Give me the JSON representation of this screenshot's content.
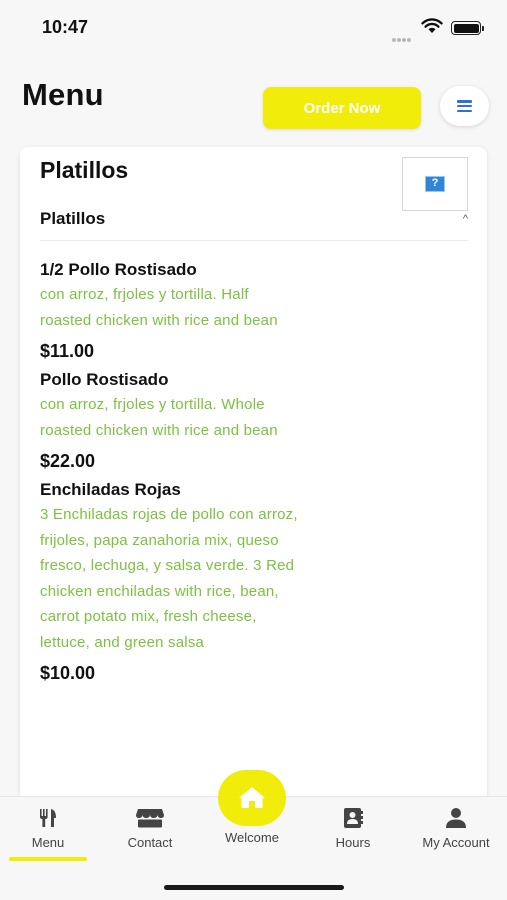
{
  "status_bar": {
    "time": "10:47"
  },
  "header": {
    "title": "Menu",
    "order_button_label": "Order Now",
    "menu_icon": "hamburger-icon"
  },
  "section": {
    "title": "Platillos",
    "image_icon": "broken-image-icon",
    "image_glyph": "?",
    "accordion_title": "Platillos",
    "accordion_glyph": "^"
  },
  "items": [
    {
      "name": "1/2 Pollo Rostisado",
      "description": "con arroz, frjoles y tortilla. Half roasted chicken with rice and bean",
      "price": "$11.00"
    },
    {
      "name": "Pollo Rostisado",
      "description": "con arroz, frjoles y tortilla. Whole roasted chicken with rice and bean",
      "price": "$22.00"
    },
    {
      "name": "Enchiladas Rojas",
      "description": "3 Enchiladas rojas de pollo con arroz, frijoles, papa zanahoria mix, queso fresco, lechuga, y salsa verde. 3 Red chicken enchiladas with rice, bean, carrot potato mix, fresh cheese, lettuce, and green salsa",
      "price": "$10.00"
    }
  ],
  "bottom_nav": {
    "menu_label": "Menu",
    "contact_label": "Contact",
    "welcome_label": "Welcome",
    "hours_label": "Hours",
    "account_label": "My Account",
    "active": "Menu"
  },
  "colors": {
    "accent": "#f2ec0a",
    "description_text": "#7cc142",
    "menu_icon": "#2f6fd6"
  }
}
